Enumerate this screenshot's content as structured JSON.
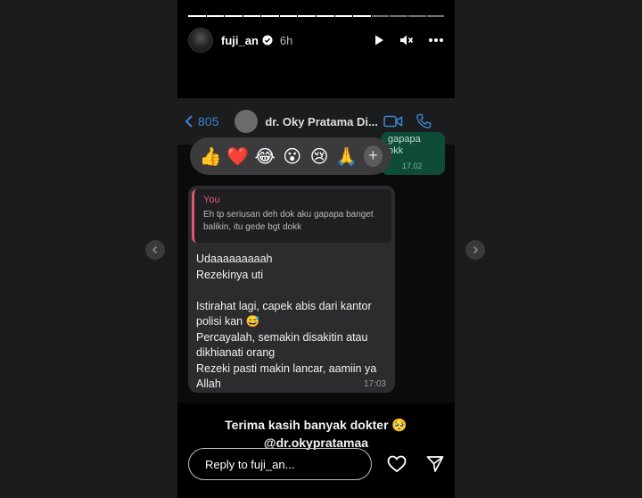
{
  "story": {
    "username": "fuji_an",
    "time": "6h",
    "progress_segments": 14,
    "progress_done": 10
  },
  "whatsapp": {
    "back_count": "805",
    "contact_name": "dr. Oky Pratama Di...",
    "bg_bubble_text": "gapapa\nokk",
    "bg_bubble_time": "17.02"
  },
  "reactions": [
    "👍",
    "❤️",
    "😂",
    "😮",
    "😢",
    "🙏"
  ],
  "message": {
    "quote_author": "You",
    "quote_text": "Eh tp seriusan deh dok aku gapapa banget balikin, itu gede bgt dokk",
    "text": "Udaaaaaaaaah\nRezekinya uti\n\nIstirahat lagi, capek abis dari kantor polisi kan 😅\nPercayalah, semakin disakitin atau dikhianati orang\nRezeki pasti makin lancar, aamiin ya Allah",
    "time": "17:03"
  },
  "caption": {
    "line1": "Terima kasih banyak dokter 🥺",
    "line2": "@dr.okypratamaa"
  },
  "reply": {
    "placeholder": "Reply to fuji_an..."
  }
}
